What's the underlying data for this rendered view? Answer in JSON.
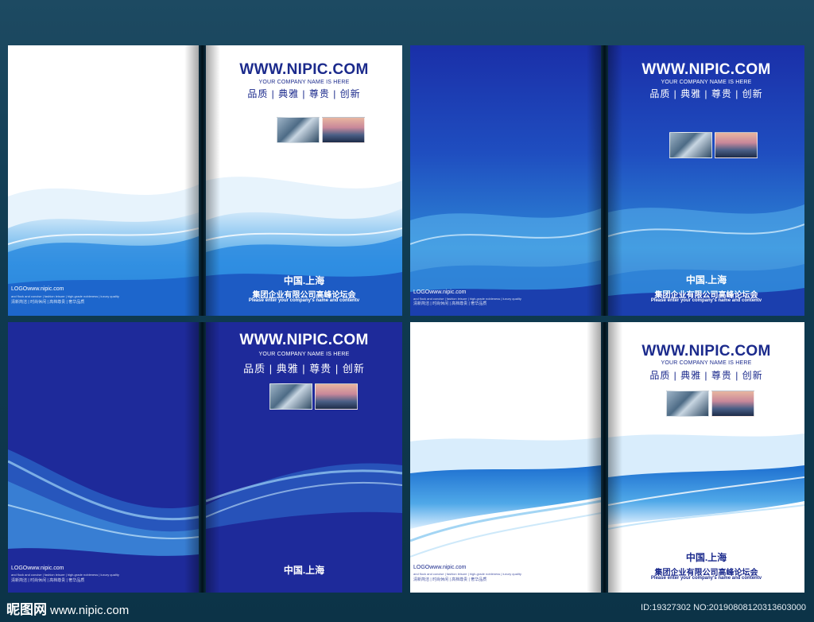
{
  "cover": {
    "site": "WWW.NIPIC.COM",
    "sub": "YOUR COMPANY NAME IS HERE",
    "slogan": "品质 | 典雅 | 尊贵 | 创新",
    "city": "中国.上海",
    "company": "集团企业有限公司高峰论坛会",
    "enter": "Please enter your company's name and contentv",
    "logo": "LOGOwww.nipic.com",
    "tiny1": "and flock and concise  |  fashion leisure  |  high-grade nobleness  |  luxury quality",
    "tiny2": "清新简洁 | 时尚休闲 | 高档尊贵 | 奢华品质"
  },
  "footer": {
    "brand": "昵图网",
    "url": "www.nipic.com",
    "id": "ID:19327302 NO:20190808120313603000"
  },
  "colors": {
    "navy": "#1b2a8c",
    "blue": "#1f4ec0",
    "background": "#0f3a50"
  }
}
